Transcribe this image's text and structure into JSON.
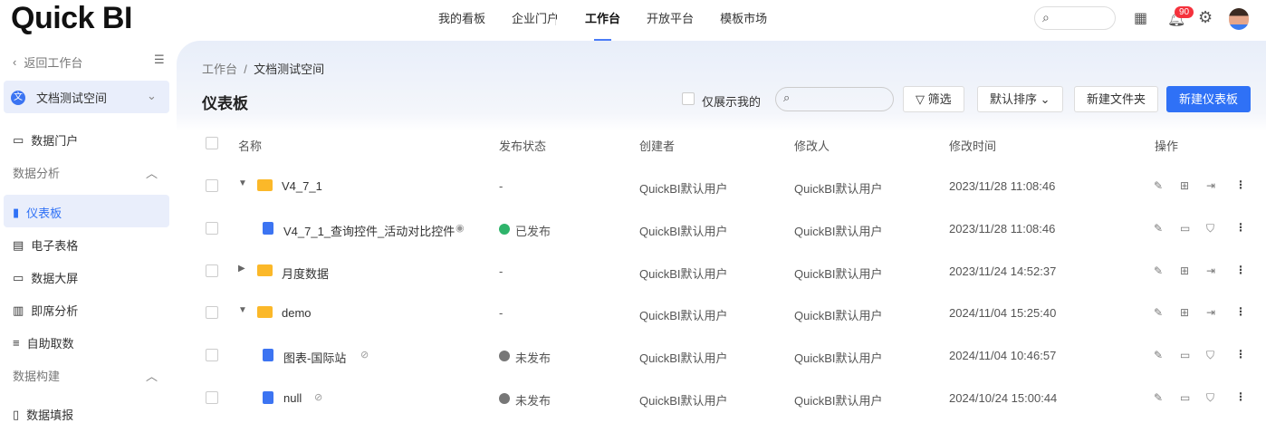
{
  "header": {
    "logo": "Quick BI",
    "nav": [
      "我的看板",
      "企业门户",
      "工作台",
      "开放平台",
      "模板市场"
    ],
    "active_nav": "工作台",
    "notification_count": "90"
  },
  "sidebar": {
    "back": "返回工作台",
    "workspace": "文档测试空间",
    "workspace_icon": "文",
    "items": [
      {
        "label": "数据门户",
        "type": "item"
      },
      {
        "label": "数据分析",
        "type": "group"
      },
      {
        "label": "仪表板",
        "type": "item",
        "active": true
      },
      {
        "label": "电子表格",
        "type": "item"
      },
      {
        "label": "数据大屏",
        "type": "item"
      },
      {
        "label": "即席分析",
        "type": "item"
      },
      {
        "label": "自助取数",
        "type": "item"
      },
      {
        "label": "数据构建",
        "type": "group"
      },
      {
        "label": "数据填报",
        "type": "item"
      }
    ]
  },
  "main": {
    "breadcrumb": [
      "工作台",
      "文档测试空间"
    ],
    "title": "仪表板",
    "only_mine": "仅展示我的",
    "filter": "筛选",
    "sort": "默认排序",
    "new_folder": "新建文件夹",
    "new_dashboard": "新建仪表板",
    "columns": [
      "名称",
      "发布状态",
      "创建者",
      "修改人",
      "修改时间",
      "操作"
    ],
    "rows": [
      {
        "name": "V4_7_1",
        "kind": "folder",
        "expanded": true,
        "indent": 0,
        "status": "-",
        "creator": "QuickBI默认用户",
        "modifier": "QuickBI默认用户",
        "time": "2023/11/28 11:08:46"
      },
      {
        "name": "V4_7_1_查询控件_活动对比控件",
        "kind": "dashboard",
        "indent": 1,
        "status": "已发布",
        "creator": "QuickBI默认用户",
        "modifier": "QuickBI默认用户",
        "time": "2023/11/28 11:08:46"
      },
      {
        "name": "月度数据",
        "kind": "folder",
        "expanded": false,
        "indent": 0,
        "status": "-",
        "creator": "QuickBI默认用户",
        "modifier": "QuickBI默认用户",
        "time": "2023/11/24 14:52:37"
      },
      {
        "name": "demo",
        "kind": "folder",
        "expanded": true,
        "indent": 0,
        "status": "-",
        "creator": "QuickBI默认用户",
        "modifier": "QuickBI默认用户",
        "time": "2024/11/04 15:25:40"
      },
      {
        "name": "图表-国际站",
        "kind": "dashboard",
        "indent": 1,
        "status": "未发布",
        "creator": "QuickBI默认用户",
        "modifier": "QuickBI默认用户",
        "time": "2024/11/04 10:46:57"
      },
      {
        "name": "null",
        "kind": "dashboard",
        "indent": 1,
        "status": "未发布",
        "creator": "QuickBI默认用户",
        "modifier": "QuickBI默认用户",
        "time": "2024/10/24 15:00:44"
      }
    ]
  }
}
